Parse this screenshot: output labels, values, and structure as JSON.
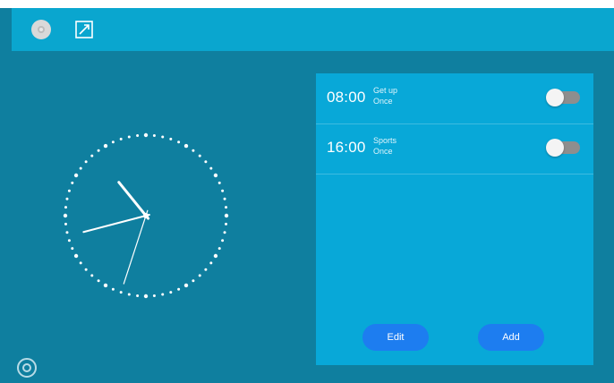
{
  "toolbar": {
    "icons": [
      "settings-icon",
      "fullscreen-icon"
    ]
  },
  "clock": {
    "hour": 10,
    "minute": 42,
    "second": 33
  },
  "alarms": [
    {
      "time": "08:00",
      "name": "Get up",
      "days": "Once",
      "enabled": false
    },
    {
      "time": "16:00",
      "name": "Sports",
      "days": "Once",
      "enabled": false
    }
  ],
  "buttons": {
    "edit": "Edit",
    "add": "Add"
  },
  "colors": {
    "background": "#0f7f9f",
    "topbar": "#0aa6cf",
    "panel": "#08a8d8",
    "button": "#1d7df0",
    "toggle_off": "#8e8e8e"
  }
}
